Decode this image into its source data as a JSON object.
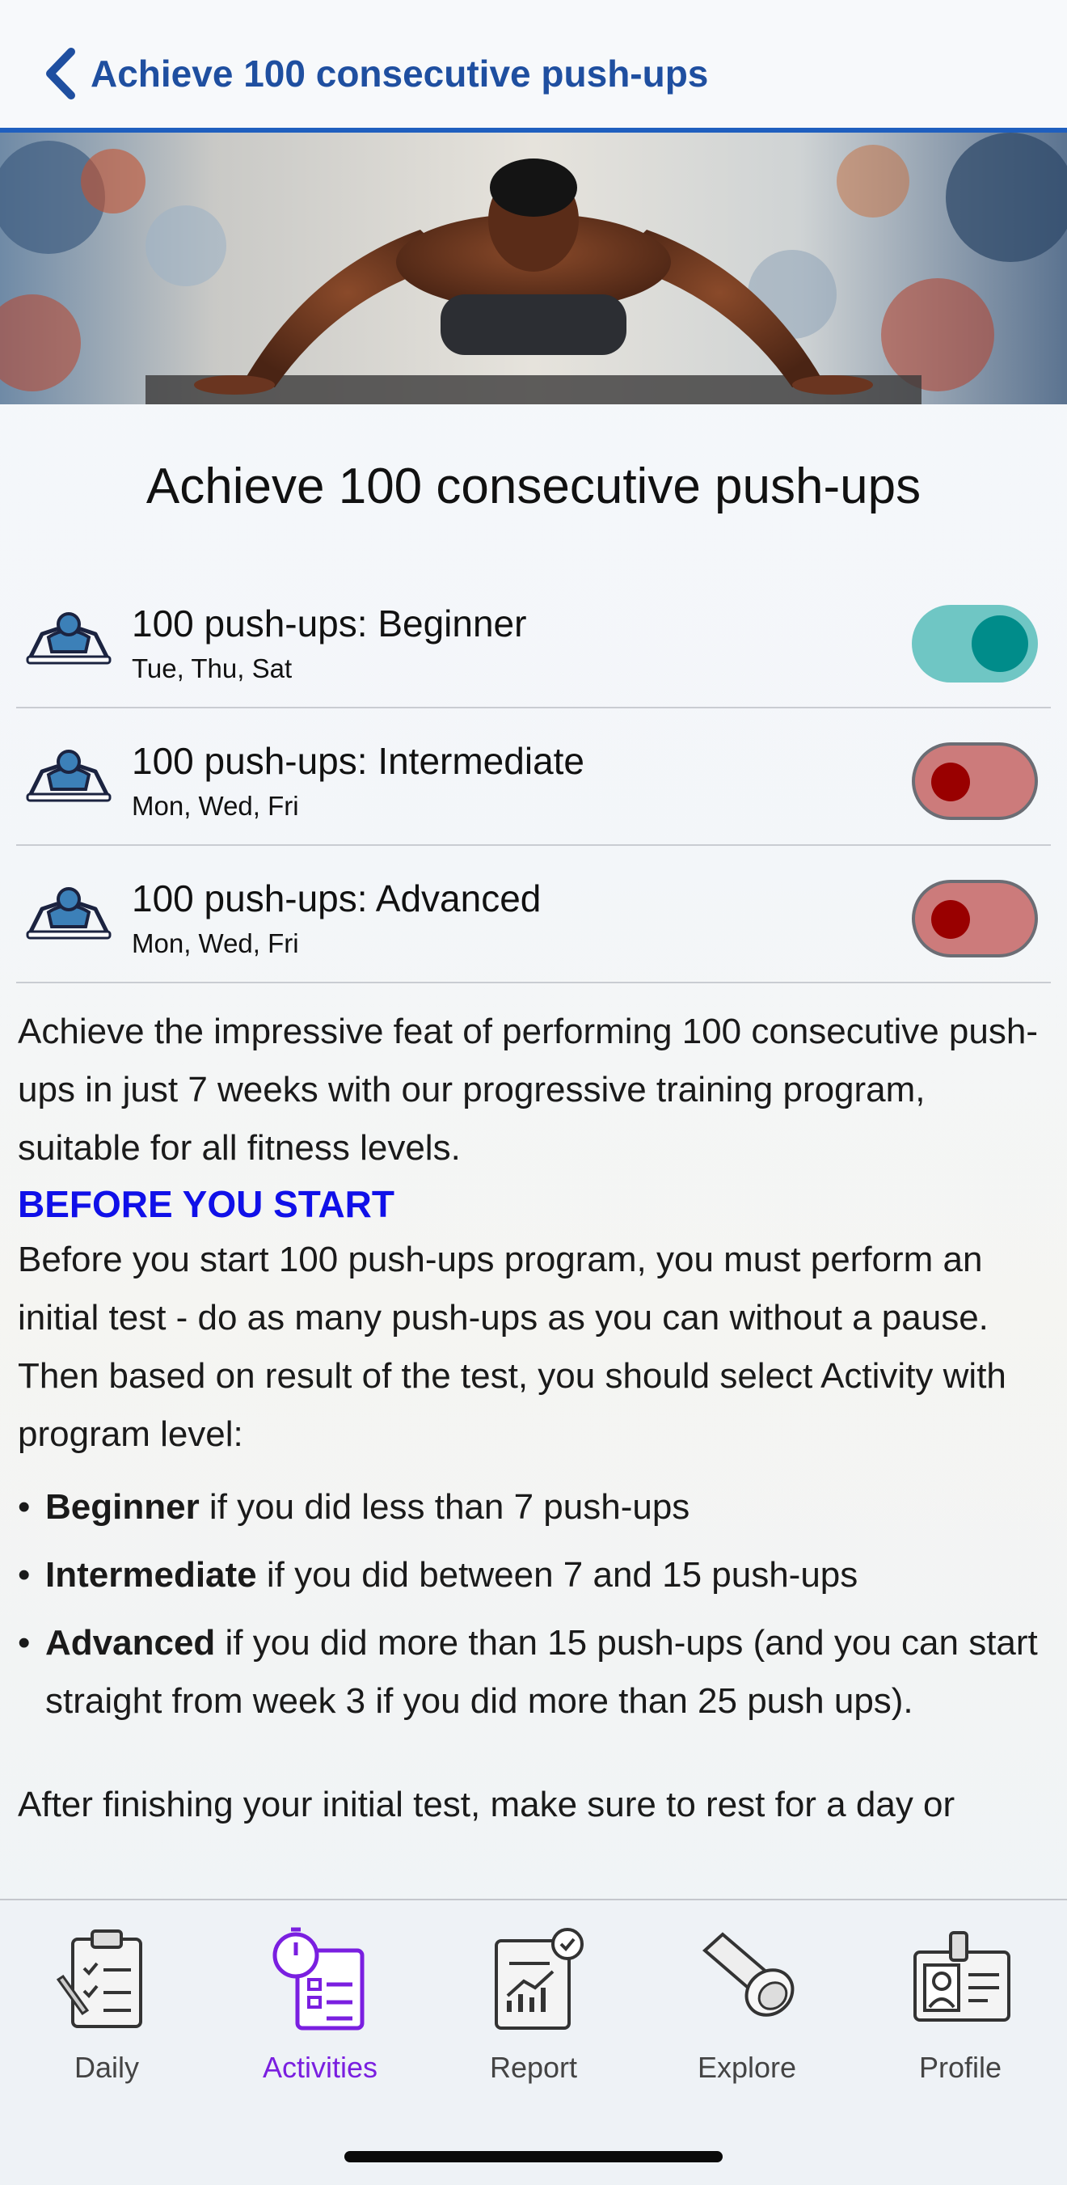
{
  "header": {
    "title": "Achieve 100 consecutive push-ups",
    "back_icon": "chevron-left-icon",
    "accent": "#1f5fbf"
  },
  "page": {
    "title": "Achieve 100 consecutive push-ups"
  },
  "activities": [
    {
      "title": "100 push-ups: Beginner",
      "days": "Tue, Thu, Sat",
      "enabled": true,
      "icon": "pushup-person-icon"
    },
    {
      "title": "100 push-ups: Intermediate",
      "days": "Mon, Wed, Fri",
      "enabled": false,
      "icon": "pushup-person-icon"
    },
    {
      "title": "100 push-ups: Advanced",
      "days": "Mon, Wed, Fri",
      "enabled": false,
      "icon": "pushup-person-icon"
    }
  ],
  "description": {
    "intro": "Achieve the impressive feat of performing 100 consecutive push-ups in just 7 weeks with our progressive training program, suitable for all fitness levels.",
    "section_heading": "BEFORE YOU START",
    "before_text": "Before you start 100 push-ups program, you must perform an initial test - do as many push-ups as you can without a pause. Then based on result of the test, you should select Activity with program level:",
    "bullets": [
      {
        "bold": "Beginner",
        "text": " if you did less than 7 push-ups"
      },
      {
        "bold": "Intermediate",
        "text": " if you did between 7 and 15 push-ups"
      },
      {
        "bold": "Advanced",
        "text": " if you did more than 15 push-ups (and you can start straight from week 3 if you did more than 25 push ups)."
      }
    ],
    "after_text": "After finishing your initial test, make sure to rest for a day or"
  },
  "tabs": [
    {
      "label": "Daily",
      "icon": "clipboard-checklist-icon",
      "active": false
    },
    {
      "label": "Activities",
      "icon": "stopwatch-checklist-icon",
      "active": true
    },
    {
      "label": "Report",
      "icon": "report-chart-icon",
      "active": false
    },
    {
      "label": "Explore",
      "icon": "flashlight-icon",
      "active": false
    },
    {
      "label": "Profile",
      "icon": "id-badge-icon",
      "active": false
    }
  ],
  "colors": {
    "toggle_on": "#6fc6c4",
    "toggle_off": "#cc7b7b",
    "active_tab": "#7a1fe0",
    "heading": "#1010e8"
  }
}
